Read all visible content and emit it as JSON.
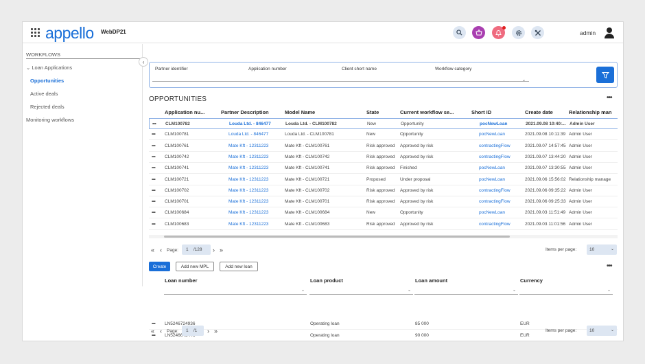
{
  "header": {
    "logo": "appello",
    "app_name": "WebDP21",
    "user": "admin",
    "icons": [
      "search-icon",
      "basket-icon",
      "bell-icon",
      "gear-icon",
      "tools-icon",
      "user-icon"
    ]
  },
  "sidebar": {
    "heading": "WORKFLOWS",
    "group": "Loan Applications",
    "items": [
      "Opportunities",
      "Active deals",
      "Rejected deals"
    ],
    "bottom": "Monitoring workflows"
  },
  "filters": {
    "partner_identifier": "Partner identifier",
    "application_number": "Application number",
    "client_short_name": "Client short name",
    "workflow_category": "Workflow category"
  },
  "opportunities": {
    "title": "OPPORTUNITIES",
    "columns": [
      "Application nu...",
      "Partner Description",
      "Model Name",
      "State",
      "Current workflow se...",
      "Short ID",
      "Create date",
      "Relationship man"
    ],
    "rows": [
      [
        "CLM100782",
        "Louda Ltd. - 846477",
        "Louda Ltd. - CLM100782",
        "New",
        "Opportunity",
        "pocNewLoan",
        "2021.09.08 10:40:...",
        "Admin User"
      ],
      [
        "CLM100781",
        "Louda Ltd. - 846477",
        "Louda Ltd. - CLM100781",
        "New",
        "Opportunity",
        "pocNewLoan",
        "2021.09.08 10:11:39",
        "Admin User"
      ],
      [
        "CLM100761",
        "Mate Kft - 12311223",
        "Mate Kft - CLM100761",
        "Risk approved",
        "Approved by risk",
        "contractingFlow",
        "2021.09.07 14:57:45",
        "Admin User"
      ],
      [
        "CLM100742",
        "Mate Kft - 12311223",
        "Mate Kft - CLM100742",
        "Risk approved",
        "Approved by risk",
        "contractingFlow",
        "2021.09.07 13:44:20",
        "Admin User"
      ],
      [
        "CLM100741",
        "Mate Kft - 12311223",
        "Mate Kft - CLM100741",
        "Risk approved",
        "Finished",
        "pocNewLoan",
        "2021.09.07 13:30:55",
        "Admin User"
      ],
      [
        "CLM100721",
        "Mate Kft - 12311223",
        "Mate Kft - CLM100721",
        "Proposed",
        "Under proposal",
        "pocNewLoan",
        "2021.09.06 15:56:02",
        "Relationship manage"
      ],
      [
        "CLM100702",
        "Mate Kft - 12311223",
        "Mate Kft - CLM100702",
        "Risk approved",
        "Approved by risk",
        "contractingFlow",
        "2021.09.06 09:35:22",
        "Admin User"
      ],
      [
        "CLM100701",
        "Mate Kft - 12311223",
        "Mate Kft - CLM100701",
        "Risk approved",
        "Approved by risk",
        "contractingFlow",
        "2021.09.06 09:25:33",
        "Admin User"
      ],
      [
        "CLM100684",
        "Mate Kft - 12311223",
        "Mate Kft - CLM100684",
        "New",
        "Opportunity",
        "pocNewLoan",
        "2021.09.03 11:51:49",
        "Admin User"
      ],
      [
        "CLM100683",
        "Mate Kft - 12311223",
        "Mate Kft - CLM100683",
        "Risk approved",
        "Approved by risk",
        "contractingFlow",
        "2021.09.03 11:01:56",
        "Admin User"
      ]
    ],
    "pager": {
      "page_label": "Page:",
      "page": "1",
      "total": "/128",
      "ipp_label": "Items per page:",
      "ipp": "10"
    }
  },
  "loans": {
    "buttons": {
      "create": "Create",
      "add_mpl": "Add new MPL",
      "add_loan": "Add new loan"
    },
    "columns": [
      "Loan number",
      "Loan product",
      "Loan amount",
      "Currency"
    ],
    "rows": [
      [
        "LN5246724936",
        "Operating loan",
        "85 000",
        "EUR"
      ],
      [
        "LN5246643446",
        "Operating loan",
        "90 000",
        "EUR"
      ]
    ],
    "pager": {
      "page_label": "Page:",
      "page": "1",
      "total": "/1",
      "ipp_label": "Items per page:",
      "ipp": "10"
    }
  },
  "colors": {
    "accent": "#1a6fd8",
    "basket": "#a93fb0",
    "bell": "#ef6b7f"
  }
}
